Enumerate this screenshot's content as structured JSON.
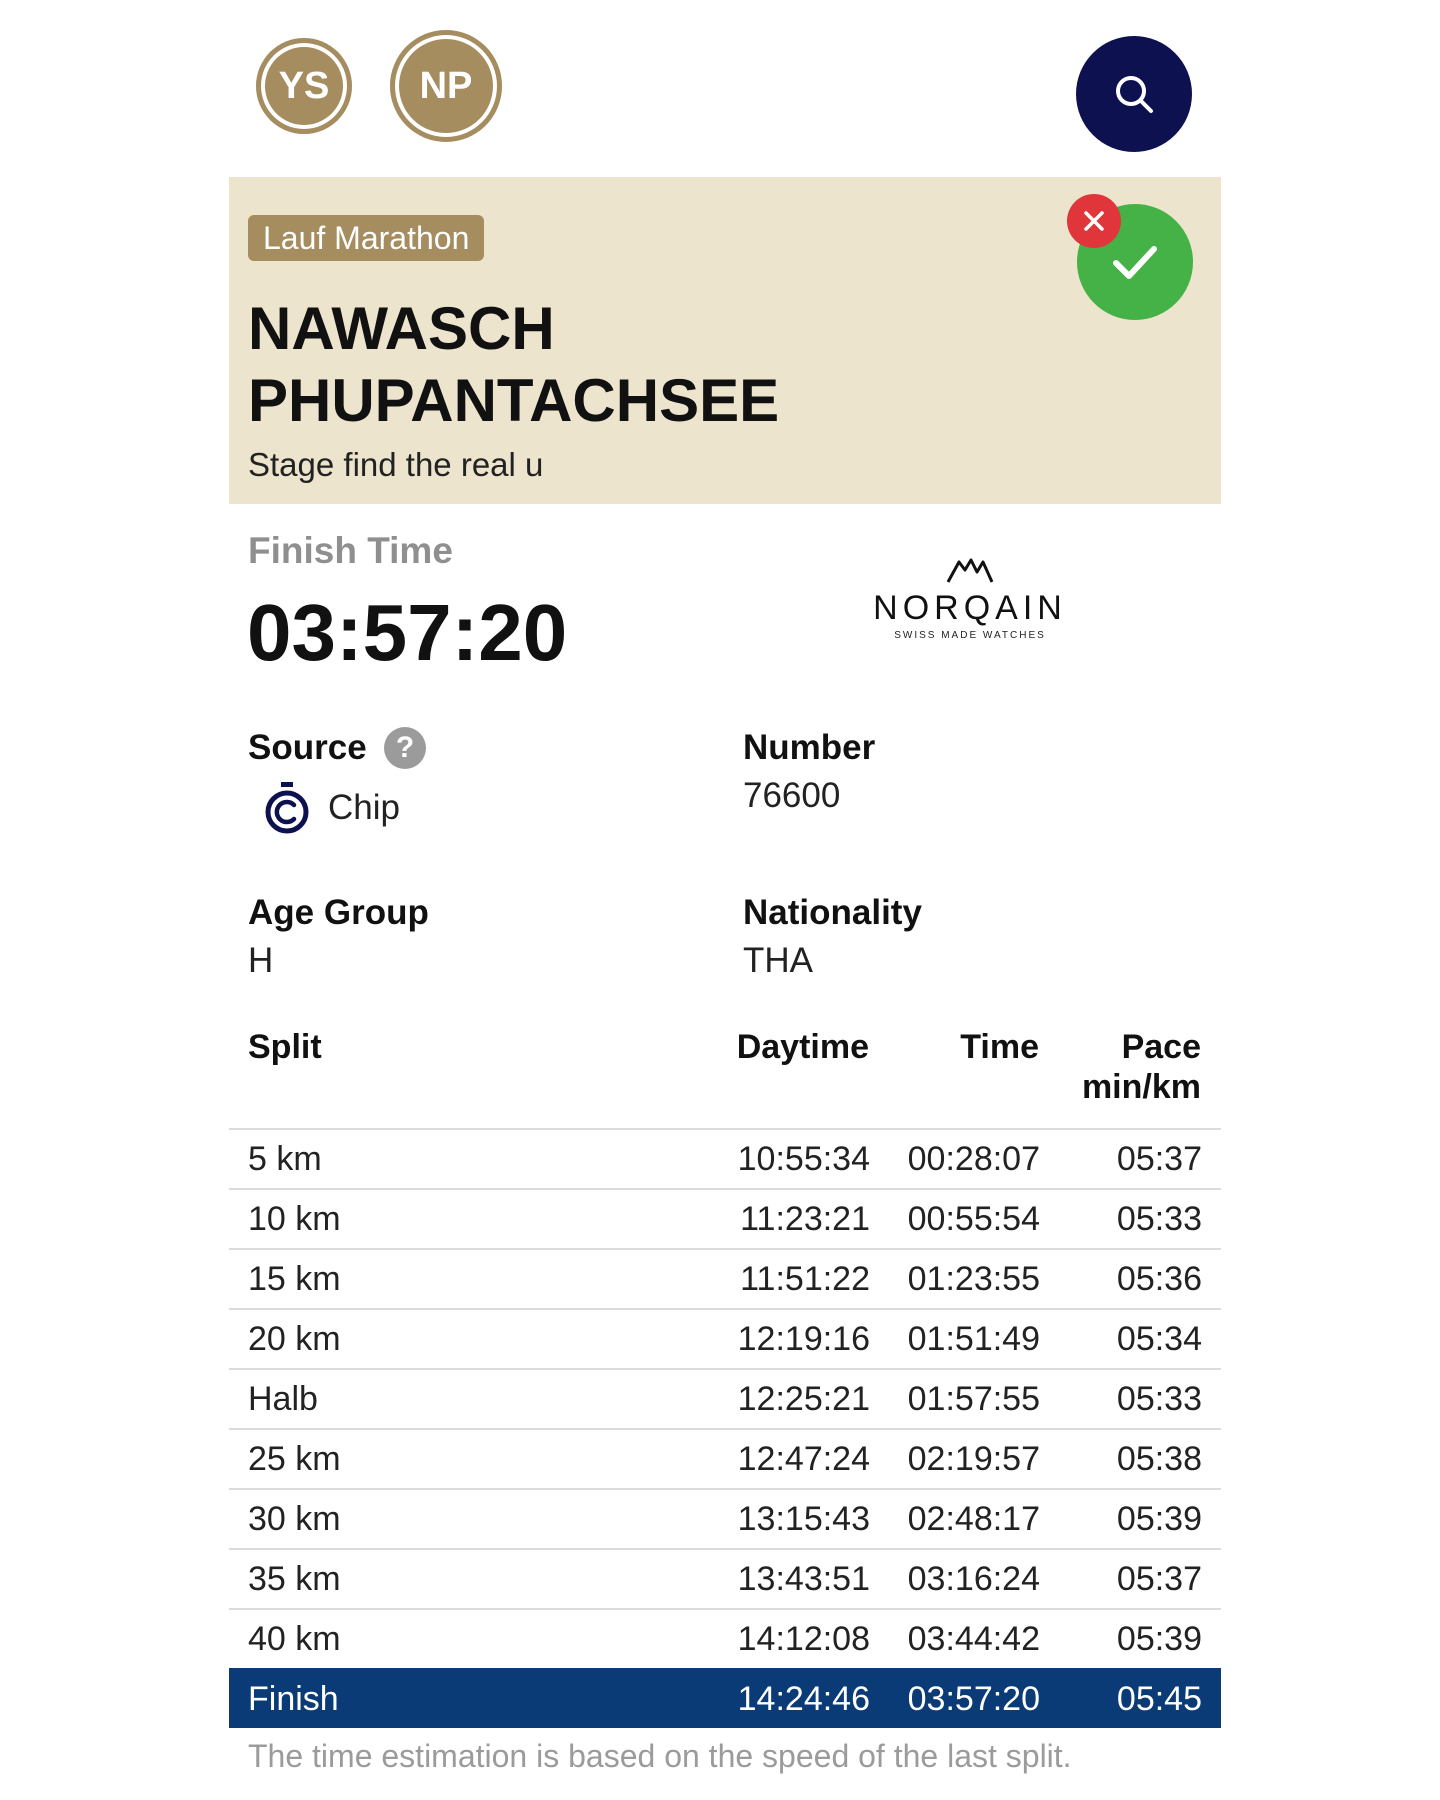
{
  "header": {
    "avatars": [
      {
        "initials": "YS"
      },
      {
        "initials": "NP"
      }
    ],
    "search_icon": "search-icon"
  },
  "runner_card": {
    "event_tag": "Lauf Marathon",
    "name_line1": "NAWASCH",
    "name_line2": "PHUPANTACHSEE",
    "subtitle": "Stage find the real u",
    "status_icon": "check-icon",
    "dismiss_icon": "close-icon",
    "colors": {
      "card_bg": "#ece4cd",
      "tag_bg": "#a68d5f",
      "check": "#44b246",
      "dismiss": "#e0353b"
    }
  },
  "finish": {
    "label": "Finish Time",
    "value": "03:57:20"
  },
  "sponsor": {
    "name": "NORQAIN",
    "tagline": "SWISS MADE WATCHES"
  },
  "details": {
    "source_label": "Source",
    "source_help": "?",
    "source_value": "Chip",
    "number_label": "Number",
    "number_value": "76600",
    "age_group_label": "Age Group",
    "age_group_value": "H",
    "nationality_label": "Nationality",
    "nationality_value": "THA"
  },
  "splits": {
    "headers": {
      "split": "Split",
      "daytime": "Daytime",
      "time": "Time",
      "pace_line1": "Pace",
      "pace_line2": "min/km"
    },
    "rows": [
      {
        "split": "5 km",
        "daytime": "10:55:34",
        "time": "00:28:07",
        "pace": "05:37"
      },
      {
        "split": "10 km",
        "daytime": "11:23:21",
        "time": "00:55:54",
        "pace": "05:33"
      },
      {
        "split": "15 km",
        "daytime": "11:51:22",
        "time": "01:23:55",
        "pace": "05:36"
      },
      {
        "split": "20 km",
        "daytime": "12:19:16",
        "time": "01:51:49",
        "pace": "05:34"
      },
      {
        "split": "Halb",
        "daytime": "12:25:21",
        "time": "01:57:55",
        "pace": "05:33"
      },
      {
        "split": "25 km",
        "daytime": "12:47:24",
        "time": "02:19:57",
        "pace": "05:38"
      },
      {
        "split": "30 km",
        "daytime": "13:15:43",
        "time": "02:48:17",
        "pace": "05:39"
      },
      {
        "split": "35 km",
        "daytime": "13:43:51",
        "time": "03:16:24",
        "pace": "05:37"
      },
      {
        "split": "40 km",
        "daytime": "14:12:08",
        "time": "03:44:42",
        "pace": "05:39"
      },
      {
        "split": "Finish",
        "daytime": "14:24:46",
        "time": "03:57:20",
        "pace": "05:45"
      }
    ],
    "note": "The time estimation is based on the speed of the last split.",
    "highlight_color": "#0b3b76"
  }
}
